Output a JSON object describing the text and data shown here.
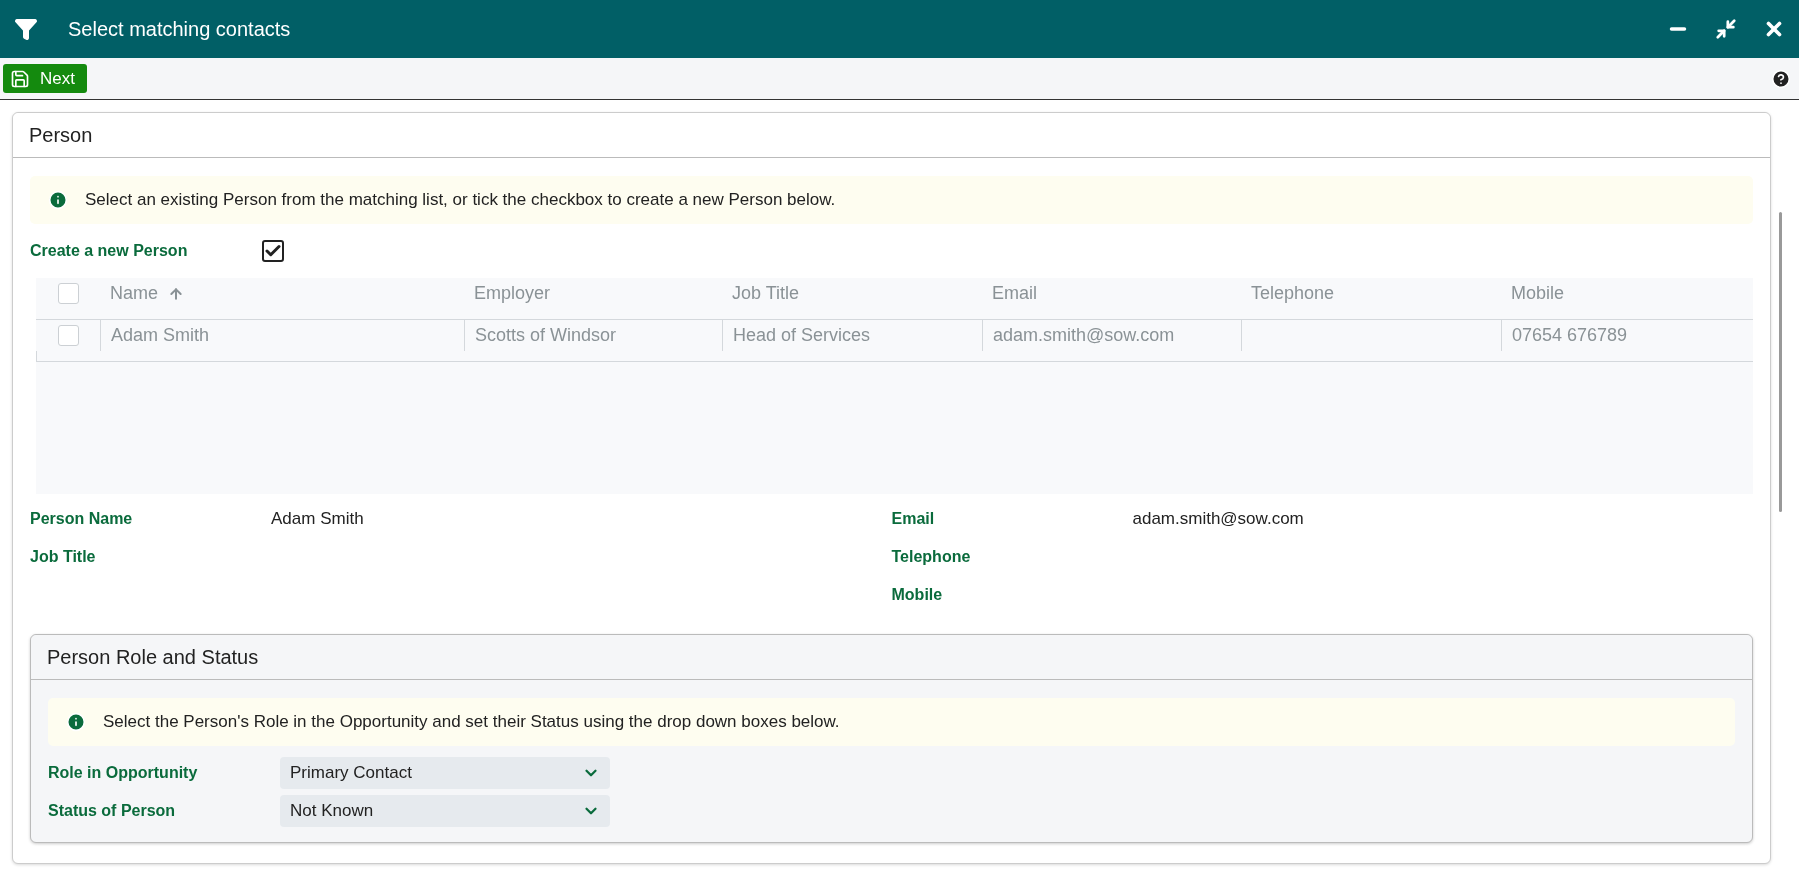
{
  "window": {
    "title": "Select matching contacts"
  },
  "toolbar": {
    "next_button": "Next"
  },
  "person_panel": {
    "title": "Person",
    "info": "Select an existing Person from the matching list, or tick the checkbox to create a new Person below.",
    "create_new": {
      "label": "Create a new Person",
      "checked": true
    },
    "table": {
      "select_all_checked": false,
      "columns": [
        {
          "label": "Name",
          "sorted": true
        },
        {
          "label": "Employer",
          "sorted": false
        },
        {
          "label": "Job Title",
          "sorted": false
        },
        {
          "label": "Email",
          "sorted": false
        },
        {
          "label": "Telephone",
          "sorted": false
        },
        {
          "label": "Mobile",
          "sorted": false
        }
      ],
      "rows": [
        {
          "selected": false,
          "cells": [
            "Adam Smith",
            "Scotts of Windsor",
            "Head of Services",
            "adam.smith@sow.com",
            "",
            "07654 676789"
          ]
        }
      ]
    },
    "details_left": [
      {
        "label": "Person Name",
        "value": "Adam Smith"
      },
      {
        "label": "Job Title"
      }
    ],
    "details_right": [
      {
        "label": "Email",
        "value": "adam.smith@sow.com"
      },
      {
        "label": "Telephone"
      },
      {
        "label": "Mobile"
      }
    ]
  },
  "role_panel": {
    "title": "Person Role and Status",
    "info": "Select the Person's Role in the Opportunity and set their Status using the drop down boxes below.",
    "fields": [
      {
        "label": "Role in Opportunity",
        "value": "Primary Contact"
      },
      {
        "label": "Status of Person",
        "value": "Not Known"
      }
    ]
  }
}
